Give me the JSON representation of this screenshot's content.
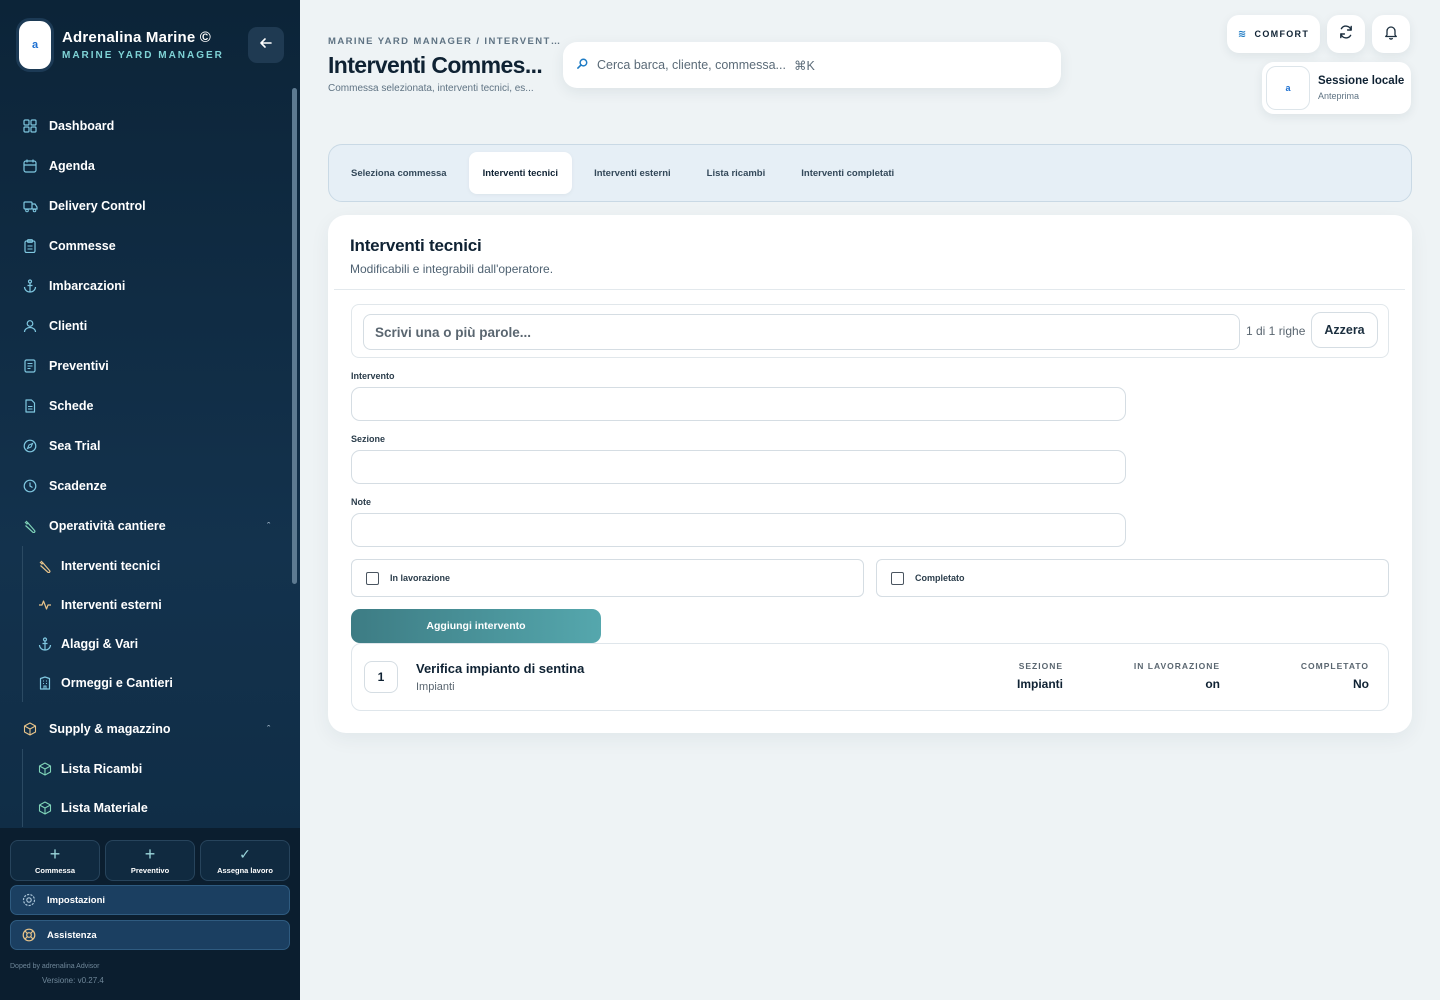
{
  "brand": {
    "name": "Adrenalina Marine ©",
    "subtitle": "MARINE YARD MANAGER",
    "logo_text": "a"
  },
  "nav": {
    "items": [
      {
        "label": "Dashboard",
        "icon": "grid-icon"
      },
      {
        "label": "Agenda",
        "icon": "calendar-icon"
      },
      {
        "label": "Delivery Control",
        "icon": "truck-icon"
      },
      {
        "label": "Commesse",
        "icon": "clipboard-icon"
      },
      {
        "label": "Imbarcazioni",
        "icon": "anchor-icon"
      },
      {
        "label": "Clienti",
        "icon": "user-icon"
      },
      {
        "label": "Preventivi",
        "icon": "receipt-icon"
      },
      {
        "label": "Schede",
        "icon": "file-icon"
      },
      {
        "label": "Sea Trial",
        "icon": "compass-icon"
      },
      {
        "label": "Scadenze",
        "icon": "clock-icon"
      }
    ],
    "group_operativita": {
      "label": "Operatività cantiere",
      "caret": "ˆ",
      "items": [
        {
          "label": "Interventi tecnici",
          "icon": "wrench-icon"
        },
        {
          "label": "Interventi esterni",
          "icon": "activity-icon"
        },
        {
          "label": "Alaggi & Vari",
          "icon": "anchor-icon"
        },
        {
          "label": "Ormeggi e Cantieri",
          "icon": "building-icon"
        }
      ]
    },
    "group_supply": {
      "label": "Supply & magazzino",
      "caret": "ˆ",
      "items": [
        {
          "label": "Lista Ricambi",
          "icon": "box-icon"
        },
        {
          "label": "Lista Materiale",
          "icon": "box-icon"
        }
      ]
    }
  },
  "quick_actions": {
    "commessa": "Commessa",
    "preventivo": "Preventivo",
    "assegna": "Assegna lavoro",
    "plus": "+",
    "check": "✓"
  },
  "footer": {
    "settings": "Impostazioni",
    "help": "Assistenza",
    "doped": "Doped by adrenalina Advisor",
    "version": "Versione: v0.27.4"
  },
  "header": {
    "breadcrumb": "MARINE YARD MANAGER / INTERVENT…",
    "title": "Interventi Commes...",
    "subtitle": "Commessa selezionata, interventi tecnici, es...",
    "search_placeholder": "Cerca barca, cliente, commessa...",
    "search_shortcut": "⌘K",
    "comfort_label": "COMFORT",
    "session_name": "Sessione locale",
    "session_sub": "Anteprima"
  },
  "tabs": [
    {
      "label": "Seleziona commessa",
      "active": false
    },
    {
      "label": "Interventi tecnici",
      "active": true
    },
    {
      "label": "Interventi esterni",
      "active": false
    },
    {
      "label": "Lista ricambi",
      "active": false
    },
    {
      "label": "Interventi completati",
      "active": false
    }
  ],
  "card": {
    "title": "Interventi tecnici",
    "subtitle": "Modificabili e integrabili dall'operatore.",
    "filter_placeholder": "Scrivi una o più parole...",
    "rows_count": "1 di 1 righe",
    "reset_label": "Azzera",
    "field_intervento": "Intervento",
    "field_sezione": "Sezione",
    "field_note": "Note",
    "check_lavorazione": "In lavorazione",
    "check_completato": "Completato",
    "add_button": "Aggiungi intervento"
  },
  "table": {
    "rows": [
      {
        "num": "1",
        "title": "Verifica impianto di sentina",
        "subtitle": "Impianti",
        "sezione_header": "SEZIONE",
        "sezione": "Impianti",
        "lavorazione_header": "IN LAVORAZIONE",
        "lavorazione": "on",
        "completato_header": "COMPLETATO",
        "completato": "No"
      }
    ]
  },
  "colors": {
    "accent": "#1e7bc4",
    "sidebar": "#0c2438",
    "button": "#4a9197"
  }
}
